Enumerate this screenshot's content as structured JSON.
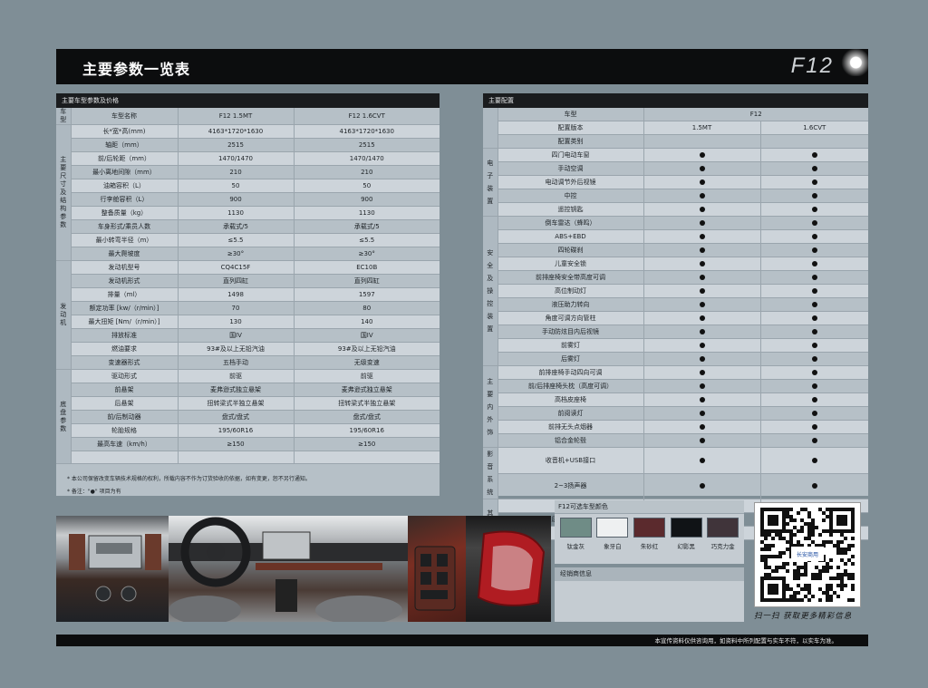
{
  "header": {
    "title": "主要参数一览表",
    "model": "F12"
  },
  "left_panel": {
    "title": "主要车型参数及价格",
    "rows": [
      {
        "cat": "车型",
        "span": 1,
        "label": "车型名称",
        "v1": "F12 1.5MT",
        "v2": "F12 1.6CVT"
      },
      {
        "cat": "主要尺寸及结构参数",
        "span": 10,
        "label": "长*宽*高(mm)",
        "v1": "4163*1720*1630",
        "v2": "4163*1720*1630"
      },
      {
        "label": "轴距（mm）",
        "v1": "2515",
        "v2": "2515"
      },
      {
        "label": "前/后轮距（mm）",
        "v1": "1470/1470",
        "v2": "1470/1470"
      },
      {
        "label": "最小离地间隙（mm）",
        "v1": "210",
        "v2": "210"
      },
      {
        "label": "油箱容积（L）",
        "v1": "50",
        "v2": "50"
      },
      {
        "label": "行李舱容积（L）",
        "v1": "900",
        "v2": "900"
      },
      {
        "label": "整备质量（kg）",
        "v1": "1130",
        "v2": "1130"
      },
      {
        "label": "车身形式/乘员人数",
        "v1": "承载式/5",
        "v2": "承载式/5"
      },
      {
        "label": "最小转弯半径（m）",
        "v1": "≤5.5",
        "v2": "≤5.5"
      },
      {
        "label": "最大爬坡度",
        "v1": "≥30°",
        "v2": "≥30°"
      },
      {
        "cat": "发动机",
        "span": 8,
        "label": "发动机型号",
        "v1": "CQ4C15F",
        "v2": "EC10B"
      },
      {
        "label": "发动机形式",
        "v1": "直列四缸",
        "v2": "直列四缸"
      },
      {
        "label": "排量（ml）",
        "v1": "1498",
        "v2": "1597"
      },
      {
        "label": "额定功率 [kw/（r/min）]",
        "v1": "70",
        "v2": "80"
      },
      {
        "label": "最大扭矩 [Nm/（r/min）]",
        "v1": "130",
        "v2": "140"
      },
      {
        "label": "排放标准",
        "v1": "国IV",
        "v2": "国IV"
      },
      {
        "label": "燃油要求",
        "v1": "93#及以上无铅汽油",
        "v2": "93#及以上无铅汽油"
      },
      {
        "label": "变速器形式",
        "v1": "五档手动",
        "v2": "无级变速"
      },
      {
        "cat": "底盘参数",
        "span": 7,
        "label": "驱动形式",
        "v1": "前驱",
        "v2": "前驱"
      },
      {
        "label": "前悬架",
        "v1": "麦弗逊式独立悬架",
        "v2": "麦弗逊式独立悬架"
      },
      {
        "label": "后悬架",
        "v1": "扭转梁式半独立悬架",
        "v2": "扭转梁式半独立悬架"
      },
      {
        "label": "前/后制动器",
        "v1": "盘式/盘式",
        "v2": "盘式/盘式"
      },
      {
        "label": "轮胎规格",
        "v1": "195/60R16",
        "v2": "195/60R16"
      },
      {
        "label": "最高车速（km/h）",
        "v1": "≥150",
        "v2": "≥150"
      },
      {
        "label": "",
        "v1": "",
        "v2": ""
      }
    ],
    "notes": [
      "* 本公司保留改变车辆技术规格的权利，所载内容不作为订货验收的依据，如有变更，恕不另行通知。",
      "* 备注：\"●\" 项目为有"
    ]
  },
  "right_panel": {
    "title": "主要配置",
    "header_rows": [
      {
        "label": "车型",
        "v": "F12"
      },
      {
        "label": "配置版本",
        "v1": "1.5MT",
        "v2": "1.6CVT"
      },
      {
        "label": "配置类别",
        "v1": "",
        "v2": ""
      }
    ],
    "groups": [
      {
        "cat": "电子装置",
        "items": [
          "四门电动车窗",
          "手动空调",
          "电动调节外后视镜",
          "中控",
          "遥控钥匙"
        ]
      },
      {
        "cat": "安全及操控装置",
        "items": [
          "倒车雷达（蜂鸣）",
          "ABS+EBD",
          "四轮碟刹",
          "儿童安全锁",
          "前排座椅安全带高度可调",
          "高位制动灯",
          "液压助力转向",
          "角度可调方向管柱",
          "手动防炫目内后视镜",
          "前雾灯",
          "后雾灯"
        ]
      },
      {
        "cat": "主要内外饰",
        "items": [
          "前排座椅手动四向可调",
          "前/后排座椅头枕（高度可调）",
          "高档皮座椅",
          "前阅读灯",
          "前排无头点烟器",
          "铝合金轮毂"
        ]
      },
      {
        "cat": "影音系统",
        "items": [
          "收音机+USB接口",
          "2~3扬声器"
        ]
      },
      {
        "cat": "其他",
        "items": [
          "后除霜",
          "后雨刮带喷淋",
          "顶置行李架"
        ]
      }
    ]
  },
  "colors": {
    "title": "F12可选车型颜色",
    "items": [
      {
        "name": "钛金灰",
        "hex": "#6f8c86"
      },
      {
        "name": "象牙白",
        "hex": "#eef0f1"
      },
      {
        "name": "朱砂红",
        "hex": "#5b2a2d"
      },
      {
        "name": "幻影黑",
        "hex": "#101316"
      },
      {
        "name": "巧克力金",
        "hex": "#40343a"
      }
    ]
  },
  "dealer": {
    "title": "经销商信息"
  },
  "qr": {
    "caption": "扫一扫 获取更多精彩信息",
    "logo_text": "长安商用"
  },
  "footer": {
    "text": "本宣传资料仅供咨询用，如资料中所列配置与实车不符，以实车为准。"
  }
}
